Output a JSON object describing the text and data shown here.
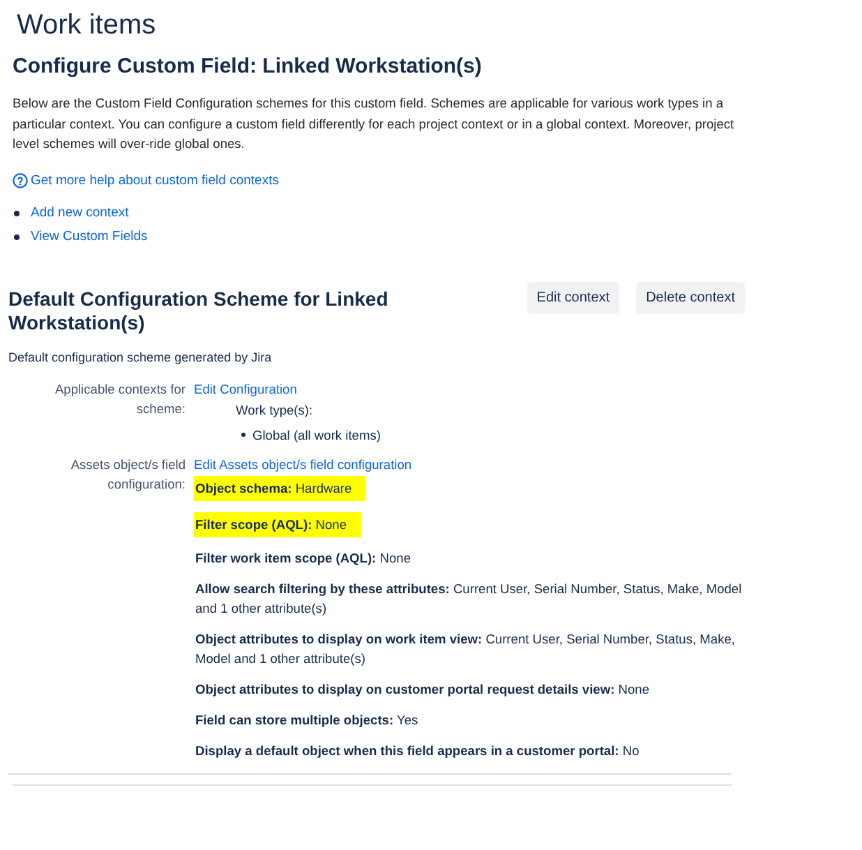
{
  "page_title": "Work items",
  "heading": "Configure Custom Field: Linked Workstation(s)",
  "description": "Below are the Custom Field Configuration schemes for this custom field. Schemes are applicable for various work types in a particular context. You can configure a custom field differently for each project context or in a global context. Moreover, project level schemes will over-ride global ones.",
  "help_link": "Get more help about custom field contexts",
  "links": [
    "Add new context",
    "View Custom Fields"
  ],
  "scheme": {
    "title": "Default Configuration Scheme for Linked Workstation(s)",
    "buttons": [
      "Edit context",
      "Delete context"
    ],
    "description": "Default configuration scheme generated by Jira",
    "contexts": {
      "label": "Applicable contexts for scheme:",
      "link": "Edit Configuration",
      "work_types_label": "Work type(s):",
      "work_types": [
        "Global (all work items)"
      ]
    },
    "assets": {
      "label": "Assets object/s field configuration:",
      "link": "Edit Assets object/s field configuration",
      "attributes": [
        {
          "label": "Object schema:",
          "value": "Hardware",
          "highlighted": true
        },
        {
          "label": "Filter scope (AQL):",
          "value": "None",
          "highlighted": true
        },
        {
          "label": "Filter work item scope (AQL):",
          "value": "None",
          "highlighted": false
        },
        {
          "label": "Allow search filtering by these attributes:",
          "value": "Current User, Serial Number, Status, Make, Model and 1 other attribute(s)",
          "highlighted": false
        },
        {
          "label": "Object attributes to display on work item view:",
          "value": "Current User, Serial Number, Status, Make, Model and 1 other attribute(s)",
          "highlighted": false
        },
        {
          "label": "Object attributes to display on customer portal request details view:",
          "value": "None",
          "highlighted": false
        },
        {
          "label": "Field can store multiple objects:",
          "value": "Yes",
          "highlighted": false
        },
        {
          "label": "Display a default object when this field appears in a customer portal:",
          "value": "No",
          "highlighted": false
        }
      ]
    }
  }
}
